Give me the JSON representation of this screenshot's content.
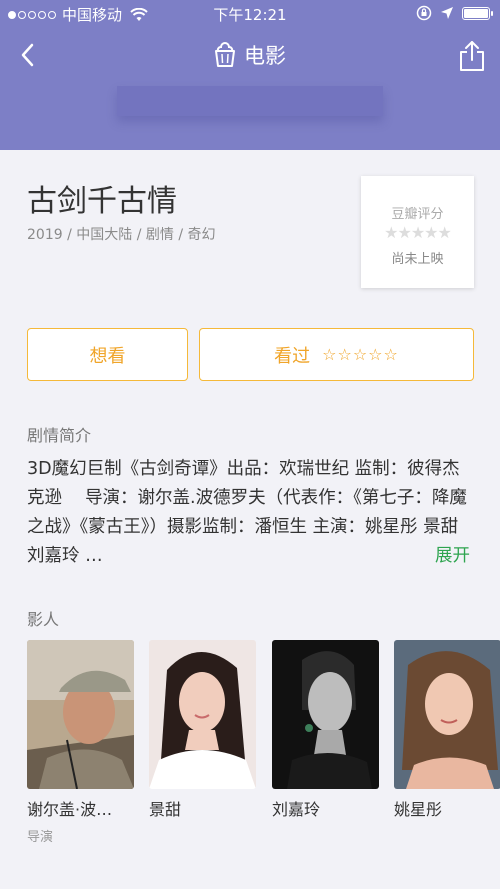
{
  "status_bar": {
    "carrier": "中国移动",
    "time": "下午12:21"
  },
  "nav": {
    "title": "电影"
  },
  "movie": {
    "title": "古剑千古情",
    "meta": "2019 / 中国大陆 / 剧情 / 奇幻"
  },
  "rating": {
    "label": "豆瓣评分",
    "stars": "★★★★★",
    "status": "尚未上映"
  },
  "actions": {
    "want_label": "想看",
    "seen_label": "看过",
    "seen_stars": "☆☆☆☆☆"
  },
  "synopsis": {
    "section_title": "剧情简介",
    "text": "3D魔幻巨制《古剑奇谭》出品：欢瑞世纪 监制：彼得杰克逊　 导演：谢尔盖.波德罗夫（代表作：《第七子：降魔之战》《蒙古王》）摄影监制：潘恒生 主演：姚星彤 景甜 刘嘉玲 …",
    "expand_label": "展开"
  },
  "cast": {
    "section_title": "影人",
    "members": [
      {
        "name": "谢尔盖·波…",
        "role": "导演"
      },
      {
        "name": "景甜",
        "role": ""
      },
      {
        "name": "刘嘉玲",
        "role": ""
      },
      {
        "name": "姚星彤",
        "role": ""
      }
    ]
  },
  "colors": {
    "header": "#7d7fc6",
    "accent": "#f0a52a",
    "expand": "#2ea44f"
  }
}
